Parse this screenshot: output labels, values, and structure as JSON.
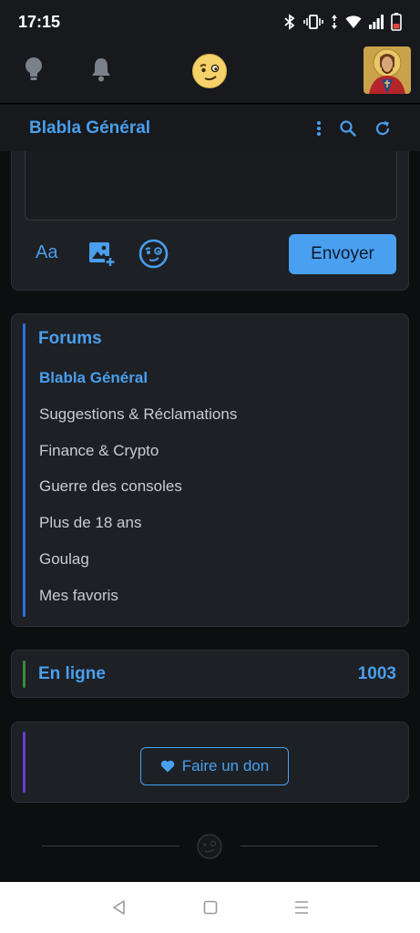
{
  "status_bar": {
    "time": "17:15",
    "icons": [
      "bluetooth-icon",
      "vibrate-icon",
      "data-arrows-icon",
      "wifi-icon",
      "signal-icon",
      "battery-icon"
    ]
  },
  "top_nav": {
    "icons": [
      "lightbulb-icon",
      "bell-icon",
      "site-logo-icon",
      "avatar"
    ]
  },
  "header": {
    "title": "Blabla Général",
    "actions": [
      "more-vertical-icon",
      "search-icon",
      "refresh-icon"
    ]
  },
  "composer": {
    "tools": [
      "text-format-icon",
      "add-image-icon",
      "emoji-icon"
    ],
    "text_format_label": "Aa",
    "send_label": "Envoyer"
  },
  "forums": {
    "title": "Forums",
    "items": [
      {
        "label": "Blabla Général",
        "active": true
      },
      {
        "label": "Suggestions & Réclamations",
        "active": false
      },
      {
        "label": "Finance & Crypto",
        "active": false
      },
      {
        "label": "Guerre des consoles",
        "active": false
      },
      {
        "label": "Plus de 18 ans",
        "active": false
      },
      {
        "label": "Goulag",
        "active": false
      },
      {
        "label": "Mes favoris",
        "active": false
      }
    ]
  },
  "online": {
    "label": "En ligne",
    "count": "1003"
  },
  "donate": {
    "label": "Faire un don"
  },
  "colors": {
    "accent": "#4a9eec",
    "forums_bar": "#2f6fd8",
    "online_bar": "#3a8a3a",
    "donate_bar": "#6a3fc8",
    "background": "#0d0e10",
    "card": "#1d2025"
  }
}
